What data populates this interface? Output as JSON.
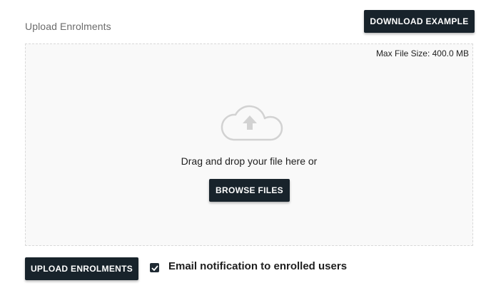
{
  "section": {
    "title": "Upload Enrolments"
  },
  "toolbar": {
    "download_label": "DOWNLOAD EXAMPLE"
  },
  "dropzone": {
    "max_size": "Max File Size: 400.0 MB",
    "icon": "cloud-upload-icon",
    "instruction": "Drag and drop your file here or",
    "browse_label": "BROWSE FILES"
  },
  "footer": {
    "upload_label": "UPLOAD ENROLMENTS",
    "email_checkbox": {
      "label": "Email notification to enrolled users",
      "checked": true
    }
  },
  "colors": {
    "button_bg": "#18232b",
    "dropzone_bg": "#f9f9f9",
    "dropzone_border": "#d9d9d9",
    "icon_gray": "#d2d2d2"
  }
}
